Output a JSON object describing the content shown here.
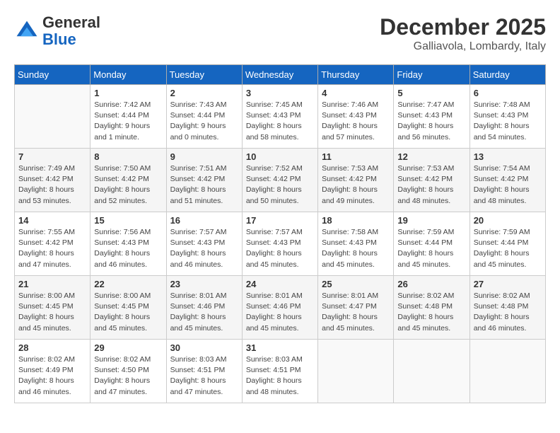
{
  "header": {
    "logo_general": "General",
    "logo_blue": "Blue",
    "month_title": "December 2025",
    "location": "Galliavola, Lombardy, Italy"
  },
  "days_of_week": [
    "Sunday",
    "Monday",
    "Tuesday",
    "Wednesday",
    "Thursday",
    "Friday",
    "Saturday"
  ],
  "weeks": [
    [
      {
        "day": "",
        "info": ""
      },
      {
        "day": "1",
        "info": "Sunrise: 7:42 AM\nSunset: 4:44 PM\nDaylight: 9 hours\nand 1 minute."
      },
      {
        "day": "2",
        "info": "Sunrise: 7:43 AM\nSunset: 4:44 PM\nDaylight: 9 hours\nand 0 minutes."
      },
      {
        "day": "3",
        "info": "Sunrise: 7:45 AM\nSunset: 4:43 PM\nDaylight: 8 hours\nand 58 minutes."
      },
      {
        "day": "4",
        "info": "Sunrise: 7:46 AM\nSunset: 4:43 PM\nDaylight: 8 hours\nand 57 minutes."
      },
      {
        "day": "5",
        "info": "Sunrise: 7:47 AM\nSunset: 4:43 PM\nDaylight: 8 hours\nand 56 minutes."
      },
      {
        "day": "6",
        "info": "Sunrise: 7:48 AM\nSunset: 4:43 PM\nDaylight: 8 hours\nand 54 minutes."
      }
    ],
    [
      {
        "day": "7",
        "info": "Sunrise: 7:49 AM\nSunset: 4:42 PM\nDaylight: 8 hours\nand 53 minutes."
      },
      {
        "day": "8",
        "info": "Sunrise: 7:50 AM\nSunset: 4:42 PM\nDaylight: 8 hours\nand 52 minutes."
      },
      {
        "day": "9",
        "info": "Sunrise: 7:51 AM\nSunset: 4:42 PM\nDaylight: 8 hours\nand 51 minutes."
      },
      {
        "day": "10",
        "info": "Sunrise: 7:52 AM\nSunset: 4:42 PM\nDaylight: 8 hours\nand 50 minutes."
      },
      {
        "day": "11",
        "info": "Sunrise: 7:53 AM\nSunset: 4:42 PM\nDaylight: 8 hours\nand 49 minutes."
      },
      {
        "day": "12",
        "info": "Sunrise: 7:53 AM\nSunset: 4:42 PM\nDaylight: 8 hours\nand 48 minutes."
      },
      {
        "day": "13",
        "info": "Sunrise: 7:54 AM\nSunset: 4:42 PM\nDaylight: 8 hours\nand 48 minutes."
      }
    ],
    [
      {
        "day": "14",
        "info": "Sunrise: 7:55 AM\nSunset: 4:42 PM\nDaylight: 8 hours\nand 47 minutes."
      },
      {
        "day": "15",
        "info": "Sunrise: 7:56 AM\nSunset: 4:43 PM\nDaylight: 8 hours\nand 46 minutes."
      },
      {
        "day": "16",
        "info": "Sunrise: 7:57 AM\nSunset: 4:43 PM\nDaylight: 8 hours\nand 46 minutes."
      },
      {
        "day": "17",
        "info": "Sunrise: 7:57 AM\nSunset: 4:43 PM\nDaylight: 8 hours\nand 45 minutes."
      },
      {
        "day": "18",
        "info": "Sunrise: 7:58 AM\nSunset: 4:43 PM\nDaylight: 8 hours\nand 45 minutes."
      },
      {
        "day": "19",
        "info": "Sunrise: 7:59 AM\nSunset: 4:44 PM\nDaylight: 8 hours\nand 45 minutes."
      },
      {
        "day": "20",
        "info": "Sunrise: 7:59 AM\nSunset: 4:44 PM\nDaylight: 8 hours\nand 45 minutes."
      }
    ],
    [
      {
        "day": "21",
        "info": "Sunrise: 8:00 AM\nSunset: 4:45 PM\nDaylight: 8 hours\nand 45 minutes."
      },
      {
        "day": "22",
        "info": "Sunrise: 8:00 AM\nSunset: 4:45 PM\nDaylight: 8 hours\nand 45 minutes."
      },
      {
        "day": "23",
        "info": "Sunrise: 8:01 AM\nSunset: 4:46 PM\nDaylight: 8 hours\nand 45 minutes."
      },
      {
        "day": "24",
        "info": "Sunrise: 8:01 AM\nSunset: 4:46 PM\nDaylight: 8 hours\nand 45 minutes."
      },
      {
        "day": "25",
        "info": "Sunrise: 8:01 AM\nSunset: 4:47 PM\nDaylight: 8 hours\nand 45 minutes."
      },
      {
        "day": "26",
        "info": "Sunrise: 8:02 AM\nSunset: 4:48 PM\nDaylight: 8 hours\nand 45 minutes."
      },
      {
        "day": "27",
        "info": "Sunrise: 8:02 AM\nSunset: 4:48 PM\nDaylight: 8 hours\nand 46 minutes."
      }
    ],
    [
      {
        "day": "28",
        "info": "Sunrise: 8:02 AM\nSunset: 4:49 PM\nDaylight: 8 hours\nand 46 minutes."
      },
      {
        "day": "29",
        "info": "Sunrise: 8:02 AM\nSunset: 4:50 PM\nDaylight: 8 hours\nand 47 minutes."
      },
      {
        "day": "30",
        "info": "Sunrise: 8:03 AM\nSunset: 4:51 PM\nDaylight: 8 hours\nand 47 minutes."
      },
      {
        "day": "31",
        "info": "Sunrise: 8:03 AM\nSunset: 4:51 PM\nDaylight: 8 hours\nand 48 minutes."
      },
      {
        "day": "",
        "info": ""
      },
      {
        "day": "",
        "info": ""
      },
      {
        "day": "",
        "info": ""
      }
    ]
  ]
}
